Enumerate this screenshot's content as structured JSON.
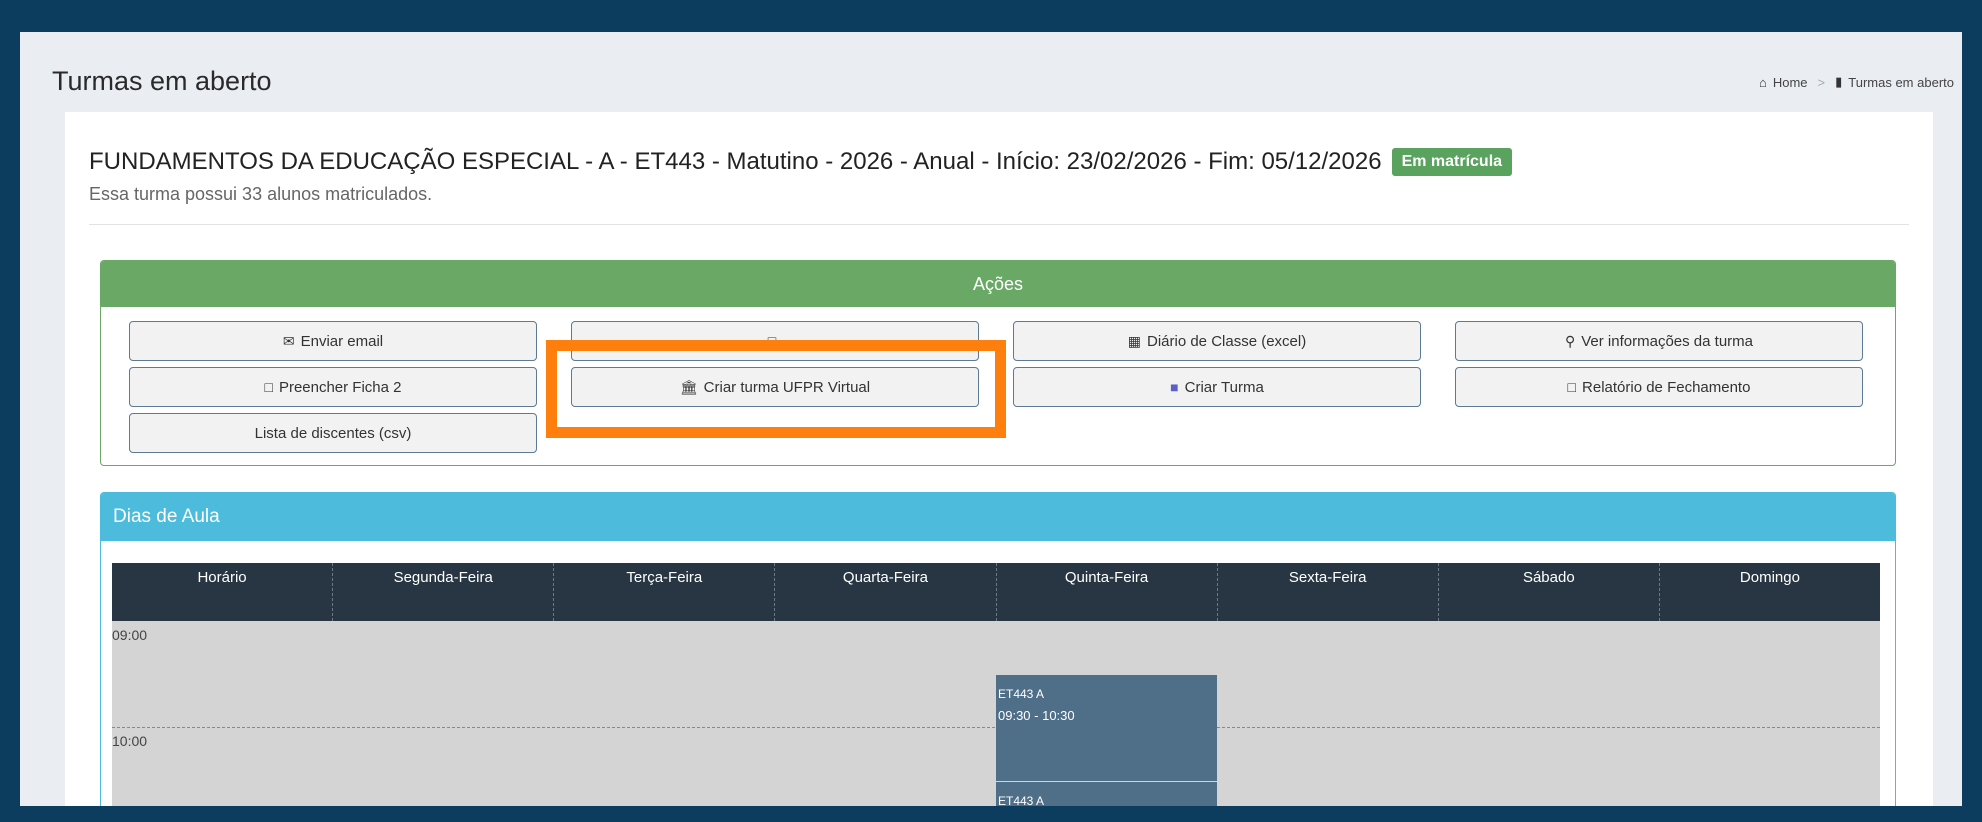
{
  "header": {
    "page_title": "Turmas em aberto",
    "breadcrumb": [
      {
        "label": "Home",
        "icon": "home-icon"
      },
      {
        "label": "Turmas em aberto",
        "icon": "book-icon"
      }
    ]
  },
  "turma": {
    "title": "FUNDAMENTOS DA EDUCAÇÃO ESPECIAL - A - ET443 - Matutino - 2026 - Anual - Início: 23/02/2026 - Fim: 05/12/2026",
    "status_badge": "Em matrícula",
    "subtitle": "Essa turma possui 33 alunos matriculados."
  },
  "acoes": {
    "header": "Ações",
    "buttons": [
      {
        "label": "Enviar email",
        "icon": "envelope-icon"
      },
      {
        "label": "",
        "icon": "file-icon"
      },
      {
        "label": "Diário de Classe (excel)",
        "icon": "file-excel-icon"
      },
      {
        "label": "Ver informações da turma",
        "icon": "search-icon"
      },
      {
        "label": "Preencher Ficha 2",
        "icon": "file-icon"
      },
      {
        "label": "Criar turma UFPR Virtual",
        "icon": "university-icon"
      },
      {
        "label": "Criar Turma",
        "icon": "teams-icon"
      },
      {
        "label": "Relatório de Fechamento",
        "icon": "file-pdf-icon"
      },
      {
        "label": "Lista de discentes (csv)",
        "icon": ""
      }
    ]
  },
  "dias_de_aula": {
    "header": "Dias de Aula",
    "columns": [
      "Horário",
      "Segunda-Feira",
      "Terça-Feira",
      "Quarta-Feira",
      "Quinta-Feira",
      "Sexta-Feira",
      "Sábado",
      "Domingo"
    ],
    "times": [
      "09:00",
      "10:00"
    ],
    "events": [
      {
        "day": "Quinta-Feira",
        "code": "ET443 A",
        "time": "09:30 - 10:30"
      },
      {
        "day": "Quinta-Feira",
        "code": "ET443 A",
        "time": ""
      }
    ]
  },
  "colors": {
    "frame": "#0c3d5e",
    "acoes_accent": "#6aa866",
    "dias_accent": "#4cbbdc",
    "badge": "#5aa35f",
    "event": "#4f6e88",
    "highlight": "#ff7f0e"
  }
}
